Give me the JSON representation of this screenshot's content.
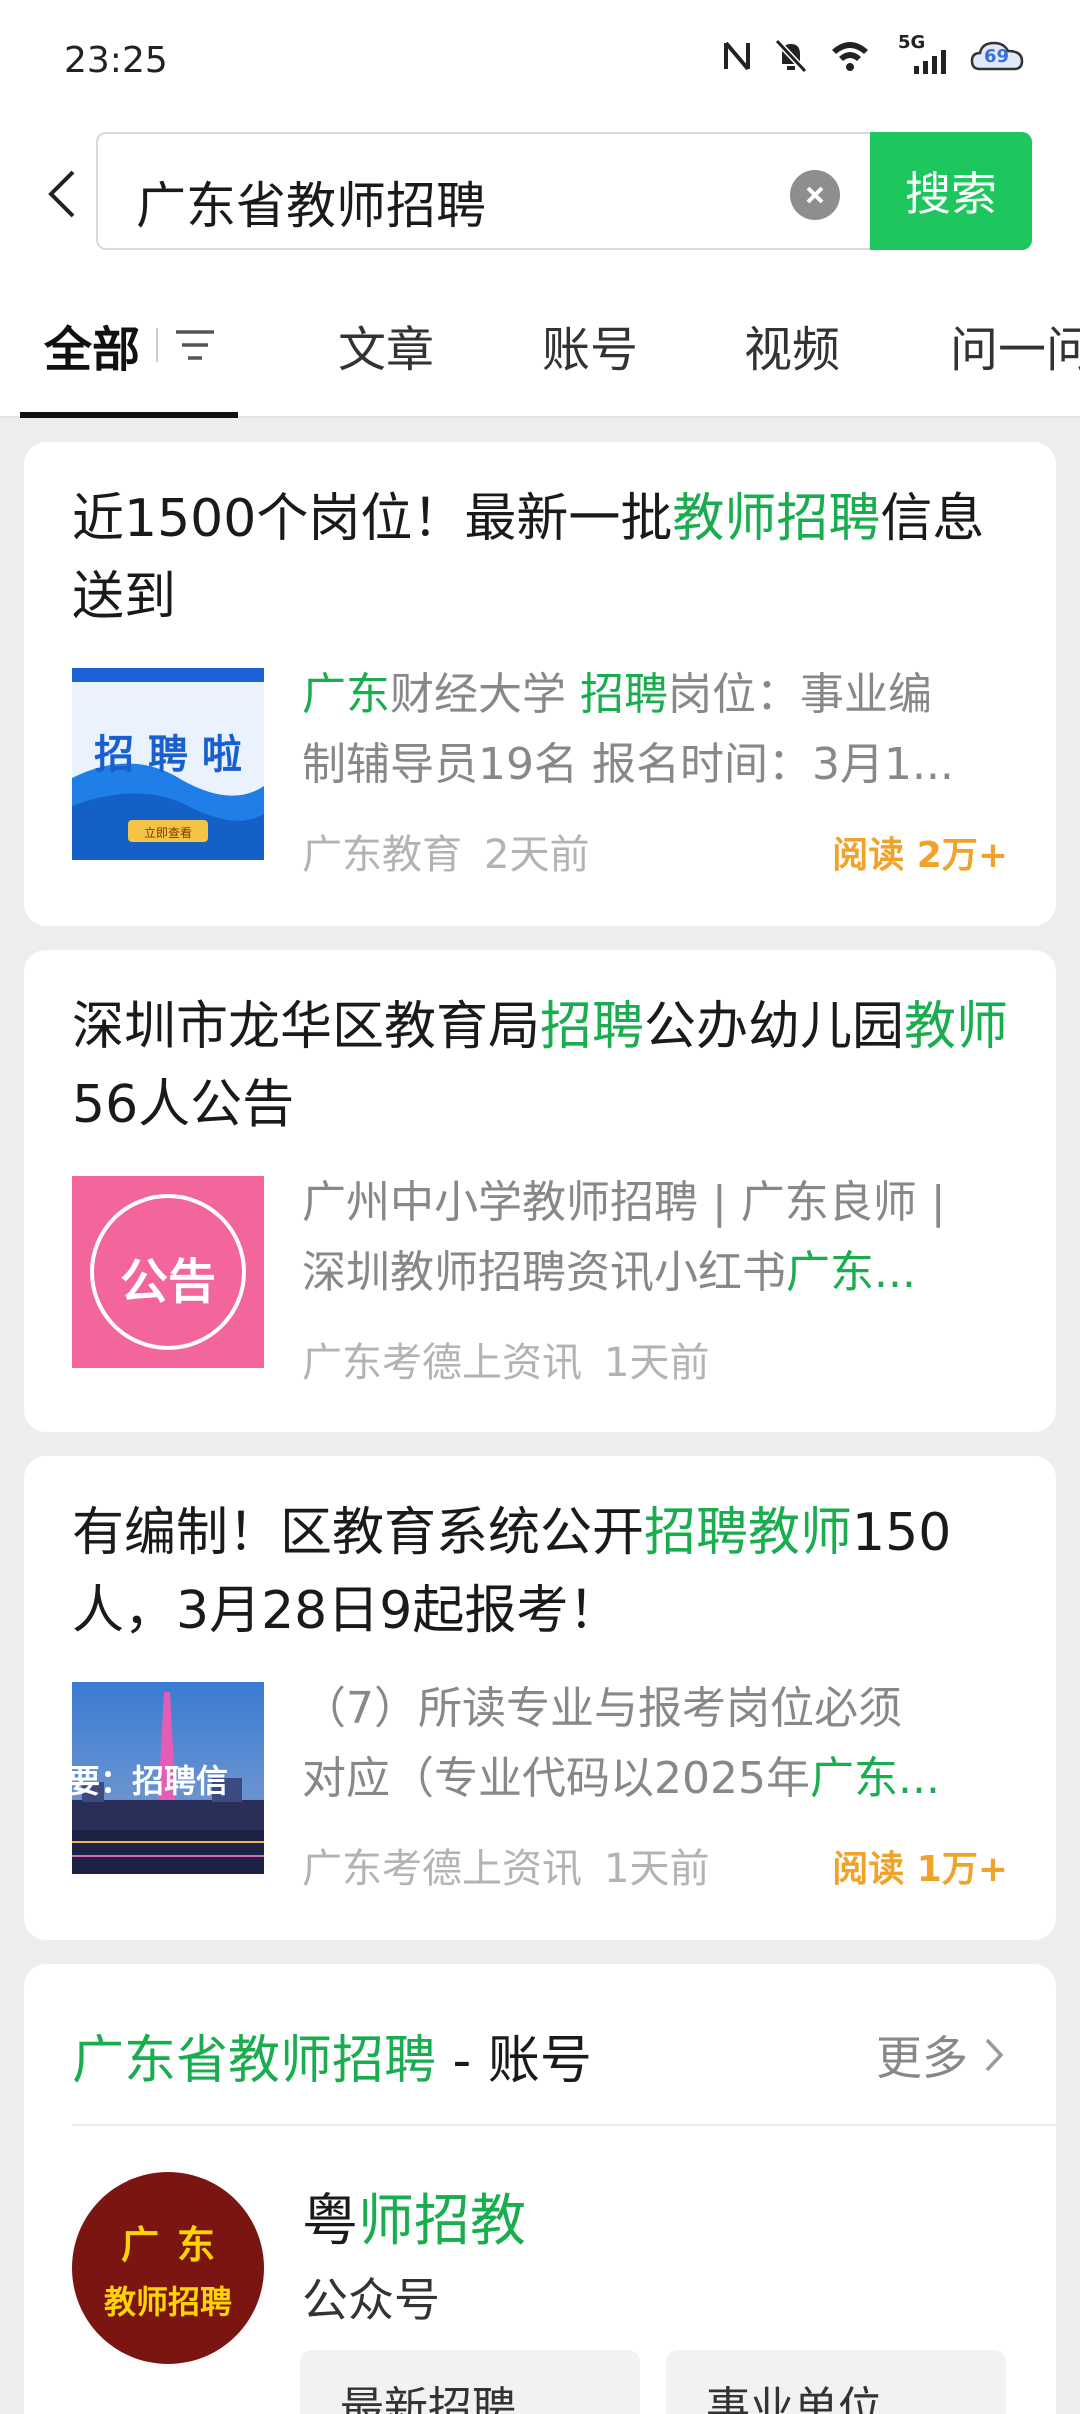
{
  "status_bar": {
    "time": "23:25",
    "network": "5G",
    "battery": "69",
    "icons": [
      "nfc-icon",
      "mute-icon",
      "wifi-icon",
      "signal-icon",
      "battery-icon"
    ]
  },
  "search": {
    "query": "广东省教师招聘",
    "button_label": "搜索"
  },
  "tabs": [
    {
      "label": "全部",
      "active": true
    },
    {
      "label": "文章"
    },
    {
      "label": "账号"
    },
    {
      "label": "视频"
    },
    {
      "label": "问一问"
    }
  ],
  "results": [
    {
      "title": {
        "t1": "近1500个岗位！最新一批",
        "t2": "教师招聘",
        "t3": "信息送到"
      },
      "snippet": {
        "s1": "广东",
        "s2": "财经大学 ",
        "s3": "招聘",
        "s4": "岗位：事业编",
        "s5": "制辅导员19名 报名时间：3月1..."
      },
      "thumb": {
        "text": "招 聘 啦",
        "button": "立即查看"
      },
      "source": "广东教育",
      "time": "2天前",
      "reads": "阅读 2万+"
    },
    {
      "title": {
        "t1": "深圳市龙华区教育局",
        "t2": "招聘",
        "t3": "公办幼儿园",
        "t4": "教师",
        "t5": "56人公告"
      },
      "snippet": {
        "s1": "广州中小学教师招聘 | 广东良师 |",
        "s2": "深圳教师招聘资讯小红书",
        "s3": "广东..."
      },
      "thumb": {
        "text": "公告"
      },
      "source": "广东考德上资讯",
      "time": "1天前"
    },
    {
      "title": {
        "t1": "有编制！区教育系统公开",
        "t2": "招聘教师",
        "t3": "150人，3月28日9起报考！"
      },
      "snippet": {
        "s1": "（7）所读专业与报考岗位必须",
        "s2": "对应（专业代码以2025年",
        "s3": "广东..."
      },
      "thumb": {
        "text": "要：招聘信"
      },
      "source": "广东考德上资讯",
      "time": "1天前",
      "reads": "阅读 1万+"
    }
  ],
  "account_section": {
    "title_hl": "广东省教师招聘",
    "title_rest": " - 账号",
    "more": "更多",
    "account": {
      "avatar_line1": "广东",
      "avatar_line2": "教师招聘",
      "name_prefix": "粤",
      "name_hl": "师招教",
      "type": "公众号",
      "chips": [
        "最新招聘",
        "事业单位"
      ]
    }
  },
  "colors": {
    "accent": "#1aad4f",
    "search_button": "#1ec65e",
    "reads": "#f0a32b"
  }
}
